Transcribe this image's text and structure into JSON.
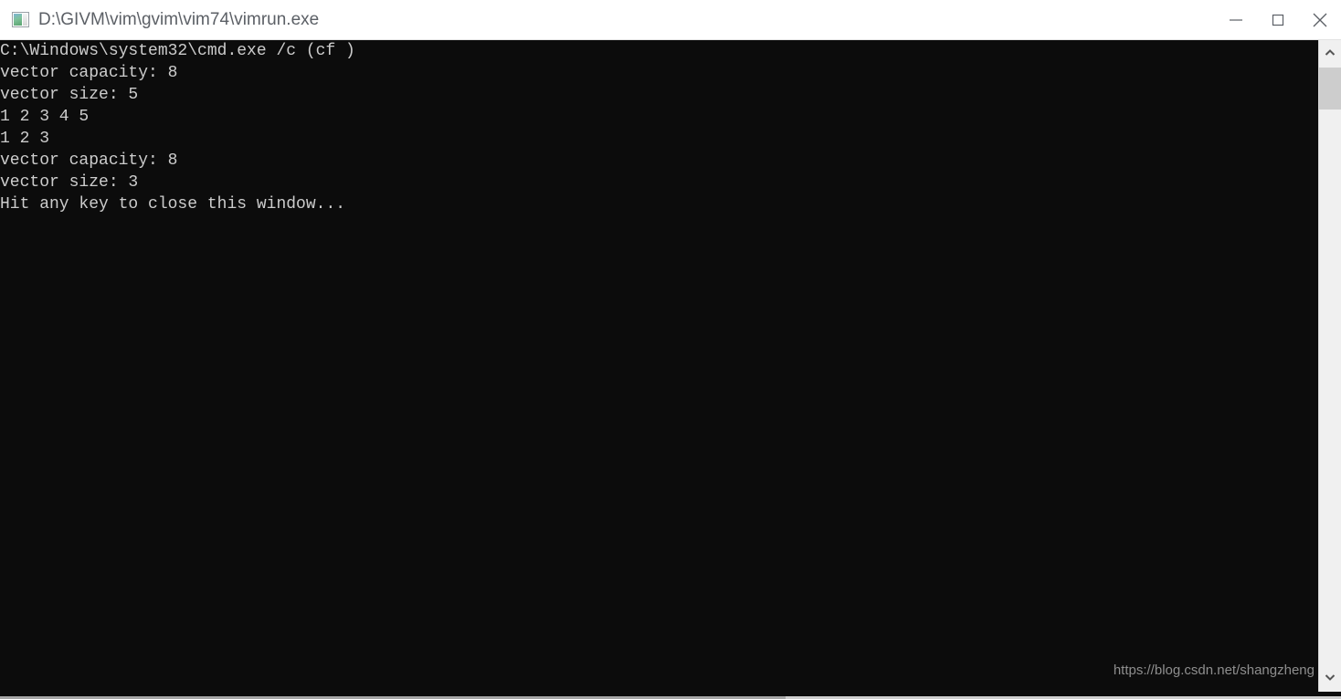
{
  "window": {
    "title": "D:\\GIVM\\vim\\gvim\\vim74\\vimrun.exe",
    "icon_name": "console-app-icon",
    "titlebar_bg": "#ffffff",
    "title_color": "#5c6066",
    "console_bg": "#0c0c0c",
    "console_fg": "#cccccc",
    "controls": {
      "minimize_label": "Minimize",
      "maximize_label": "Maximize",
      "close_label": "Close"
    }
  },
  "console": {
    "lines": [
      "C:\\Windows\\system32\\cmd.exe /c (cf )",
      "vector capacity: 8",
      "vector size: 5",
      "1 2 3 4 5",
      "1 2 3",
      "vector capacity: 8",
      "vector size: 3",
      "Hit any key to close this window..."
    ]
  },
  "watermark": {
    "text": "https://blog.csdn.net/shangzheng",
    "color": "#8e8e8e"
  },
  "scrollbars": {
    "vertical": {
      "up_arrow_icon": "chevron-up-icon",
      "down_arrow_icon": "chevron-down-icon",
      "thumb_color": "#cdcdcd",
      "track_color": "#f0f0f0"
    },
    "horizontal": {
      "thumb_color": "#a6a6a6",
      "track_color": "#cfcfcf"
    }
  }
}
